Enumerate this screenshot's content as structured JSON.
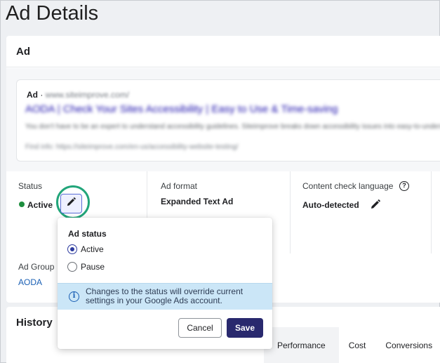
{
  "page": {
    "title": "Ad Details"
  },
  "ad_card": {
    "title": "Ad",
    "preview": {
      "label": "Ad",
      "separator": " · ",
      "url": "www.siteimprove.com/",
      "headline": "AODA | Check Your Sites Accessibility | Easy to Use & Time-saving",
      "description": "You don't have to be an expert to understand accessibility guidelines. Siteimprove breaks down accessibility issues into easy-to-understand actions, prioritizes, manageable tasks.",
      "extra": "Find info: https://siteimprove.com/en-us/accessibility-website-testing/"
    },
    "status": {
      "label": "Status",
      "value": "Active"
    },
    "ad_format": {
      "label": "Ad format",
      "value": "Expanded Text Ad"
    },
    "content_check": {
      "label": "Content check language",
      "help_icon": "?",
      "value": "Auto-detected"
    },
    "ad_group": {
      "label": "Ad Group",
      "value": "AODA"
    }
  },
  "history": {
    "title": "History",
    "tabs": [
      "Performance",
      "Cost",
      "Conversions"
    ]
  },
  "popup": {
    "title": "Ad status",
    "options": [
      {
        "label": "Active",
        "checked": true
      },
      {
        "label": "Pause",
        "checked": false
      }
    ],
    "note_icon": "i",
    "note": "Changes to the status will override current settings in your Google Ads account.",
    "cancel_label": "Cancel",
    "save_label": "Save"
  },
  "colors": {
    "accent": "#29296e",
    "status_active": "#1e8e3e",
    "highlight_ring": "#22a57a",
    "info_bg": "#cbe6f7",
    "link": "#1a5fb4"
  },
  "icons": {
    "edit": "pencil-icon",
    "help": "help-circle-icon",
    "info": "info-icon"
  }
}
